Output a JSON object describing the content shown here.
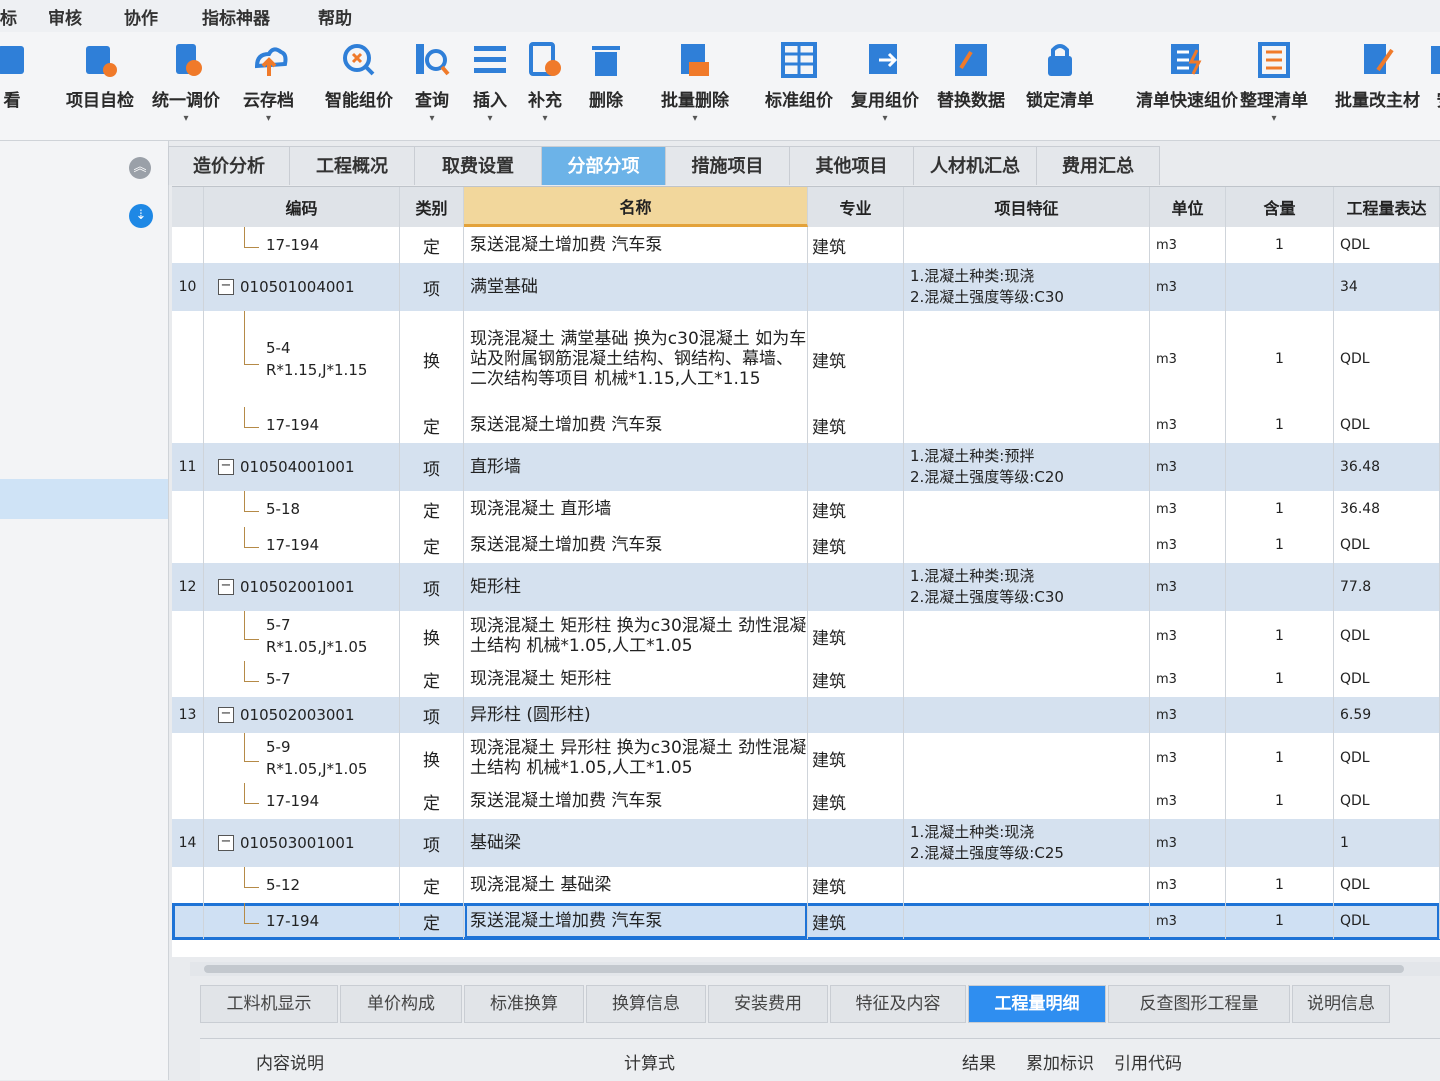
{
  "menu": [
    "标",
    "审核",
    "协作",
    "指标神器",
    "帮助"
  ],
  "toolbar": [
    {
      "label": "看",
      "icon": "view-icon",
      "caret": false
    },
    {
      "label": "项目自检",
      "icon": "project-check-icon",
      "caret": false
    },
    {
      "label": "统一调价",
      "icon": "unify-price-icon",
      "caret": true
    },
    {
      "label": "云存档",
      "icon": "cloud-save-icon",
      "caret": true
    },
    {
      "label": "智能组价",
      "icon": "smart-price-icon",
      "caret": false
    },
    {
      "label": "查询",
      "icon": "query-icon",
      "caret": true
    },
    {
      "label": "插入",
      "icon": "insert-icon",
      "caret": true
    },
    {
      "label": "补充",
      "icon": "supplement-icon",
      "caret": true
    },
    {
      "label": "删除",
      "icon": "delete-icon",
      "caret": false
    },
    {
      "label": "批量删除",
      "icon": "batch-delete-icon",
      "caret": true
    },
    {
      "label": "标准组价",
      "icon": "standard-price-icon",
      "caret": false
    },
    {
      "label": "复用组价",
      "icon": "reuse-price-icon",
      "caret": true
    },
    {
      "label": "替换数据",
      "icon": "replace-data-icon",
      "caret": false
    },
    {
      "label": "锁定清单",
      "icon": "lock-list-icon",
      "caret": false
    },
    {
      "label": "清单快速组价",
      "icon": "quick-price-icon",
      "caret": false
    },
    {
      "label": "整理清单",
      "icon": "organize-list-icon",
      "caret": true
    },
    {
      "label": "批量改主材",
      "icon": "batch-material-icon",
      "caret": false
    },
    {
      "label": "安",
      "icon": "install-icon",
      "caret": false
    }
  ],
  "tabs": [
    "造价分析",
    "工程概况",
    "取费设置",
    "分部分项",
    "措施项目",
    "其他项目",
    "人材机汇总",
    "费用汇总"
  ],
  "active_tab": "分部分项",
  "columns": [
    "编码",
    "类别",
    "名称",
    "专业",
    "项目特征",
    "单位",
    "含量",
    "工程量表达"
  ],
  "rows": [
    {
      "kind": "sub",
      "no": "",
      "code": "17-194",
      "type": "定",
      "name": "泵送混凝土增加费 汽车泵",
      "major": "建筑",
      "feature": "",
      "unit": "m3",
      "qty": "1",
      "expr": "QDL"
    },
    {
      "kind": "item",
      "no": "10",
      "code": "010501004001",
      "type": "项",
      "name": "满堂基础",
      "major": "",
      "feature": "1.混凝土种类:现浇\n2.混凝土强度等级:C30",
      "unit": "m3",
      "qty": "",
      "expr": "34"
    },
    {
      "kind": "sub",
      "no": "",
      "code": "5-4\nR*1.15,J*1.15",
      "type": "换",
      "name": "现浇混凝土 满堂基础 换为c30混凝土 如为车站及附属钢筋混凝土结构、钢结构、幕墙、二次结构等项目 机械*1.15,人工*1.15",
      "major": "建筑",
      "feature": "",
      "unit": "m3",
      "qty": "1",
      "expr": "QDL"
    },
    {
      "kind": "sub",
      "no": "",
      "code": "17-194",
      "type": "定",
      "name": "泵送混凝土增加费 汽车泵",
      "major": "建筑",
      "feature": "",
      "unit": "m3",
      "qty": "1",
      "expr": "QDL"
    },
    {
      "kind": "item",
      "no": "11",
      "code": "010504001001",
      "type": "项",
      "name": "直形墙",
      "major": "",
      "feature": "1.混凝土种类:预拌\n2.混凝土强度等级:C20",
      "unit": "m3",
      "qty": "",
      "expr": "36.48"
    },
    {
      "kind": "sub",
      "no": "",
      "code": "5-18",
      "type": "定",
      "name": "现浇混凝土 直形墙",
      "major": "建筑",
      "feature": "",
      "unit": "m3",
      "qty": "1",
      "expr": "36.48"
    },
    {
      "kind": "sub",
      "no": "",
      "code": "17-194",
      "type": "定",
      "name": "泵送混凝土增加费 汽车泵",
      "major": "建筑",
      "feature": "",
      "unit": "m3",
      "qty": "1",
      "expr": "QDL"
    },
    {
      "kind": "item",
      "no": "12",
      "code": "010502001001",
      "type": "项",
      "name": "矩形柱",
      "major": "",
      "feature": "1.混凝土种类:现浇\n2.混凝土强度等级:C30",
      "unit": "m3",
      "qty": "",
      "expr": "77.8"
    },
    {
      "kind": "sub",
      "no": "",
      "code": "5-7\nR*1.05,J*1.05",
      "type": "换",
      "name": "现浇混凝土 矩形柱 换为c30混凝土 劲性混凝土结构 机械*1.05,人工*1.05",
      "major": "建筑",
      "feature": "",
      "unit": "m3",
      "qty": "1",
      "expr": "QDL"
    },
    {
      "kind": "sub",
      "no": "",
      "code": "5-7",
      "type": "定",
      "name": "现浇混凝土 矩形柱",
      "major": "建筑",
      "feature": "",
      "unit": "m3",
      "qty": "1",
      "expr": "QDL"
    },
    {
      "kind": "item",
      "no": "13",
      "code": "010502003001",
      "type": "项",
      "name": "异形柱 (圆形柱)",
      "major": "",
      "feature": "",
      "unit": "m3",
      "qty": "",
      "expr": "6.59"
    },
    {
      "kind": "sub",
      "no": "",
      "code": "5-9\nR*1.05,J*1.05",
      "type": "换",
      "name": "现浇混凝土 异形柱 换为c30混凝土 劲性混凝土结构 机械*1.05,人工*1.05",
      "major": "建筑",
      "feature": "",
      "unit": "m3",
      "qty": "1",
      "expr": "QDL"
    },
    {
      "kind": "sub",
      "no": "",
      "code": "17-194",
      "type": "定",
      "name": "泵送混凝土增加费 汽车泵",
      "major": "建筑",
      "feature": "",
      "unit": "m3",
      "qty": "1",
      "expr": "QDL"
    },
    {
      "kind": "item",
      "no": "14",
      "code": "010503001001",
      "type": "项",
      "name": "基础梁",
      "major": "",
      "feature": "1.混凝土种类:现浇\n2.混凝土强度等级:C25",
      "unit": "m3",
      "qty": "",
      "expr": "1"
    },
    {
      "kind": "sub",
      "no": "",
      "code": "5-12",
      "type": "定",
      "name": "现浇混凝土 基础梁",
      "major": "建筑",
      "feature": "",
      "unit": "m3",
      "qty": "1",
      "expr": "QDL"
    },
    {
      "kind": "sel",
      "no": "",
      "code": "17-194",
      "type": "定",
      "name": "泵送混凝土增加费 汽车泵",
      "major": "建筑",
      "feature": "",
      "unit": "m3",
      "qty": "1",
      "expr": "QDL"
    }
  ],
  "bottom_tabs": [
    "工料机显示",
    "单价构成",
    "标准换算",
    "换算信息",
    "安装费用",
    "特征及内容",
    "工程量明细",
    "反查图形工程量",
    "说明信息"
  ],
  "active_bottom_tab": "工程量明细",
  "bottom_columns": [
    "内容说明",
    "计算式",
    "结果",
    "累加标识",
    "引用代码"
  ]
}
